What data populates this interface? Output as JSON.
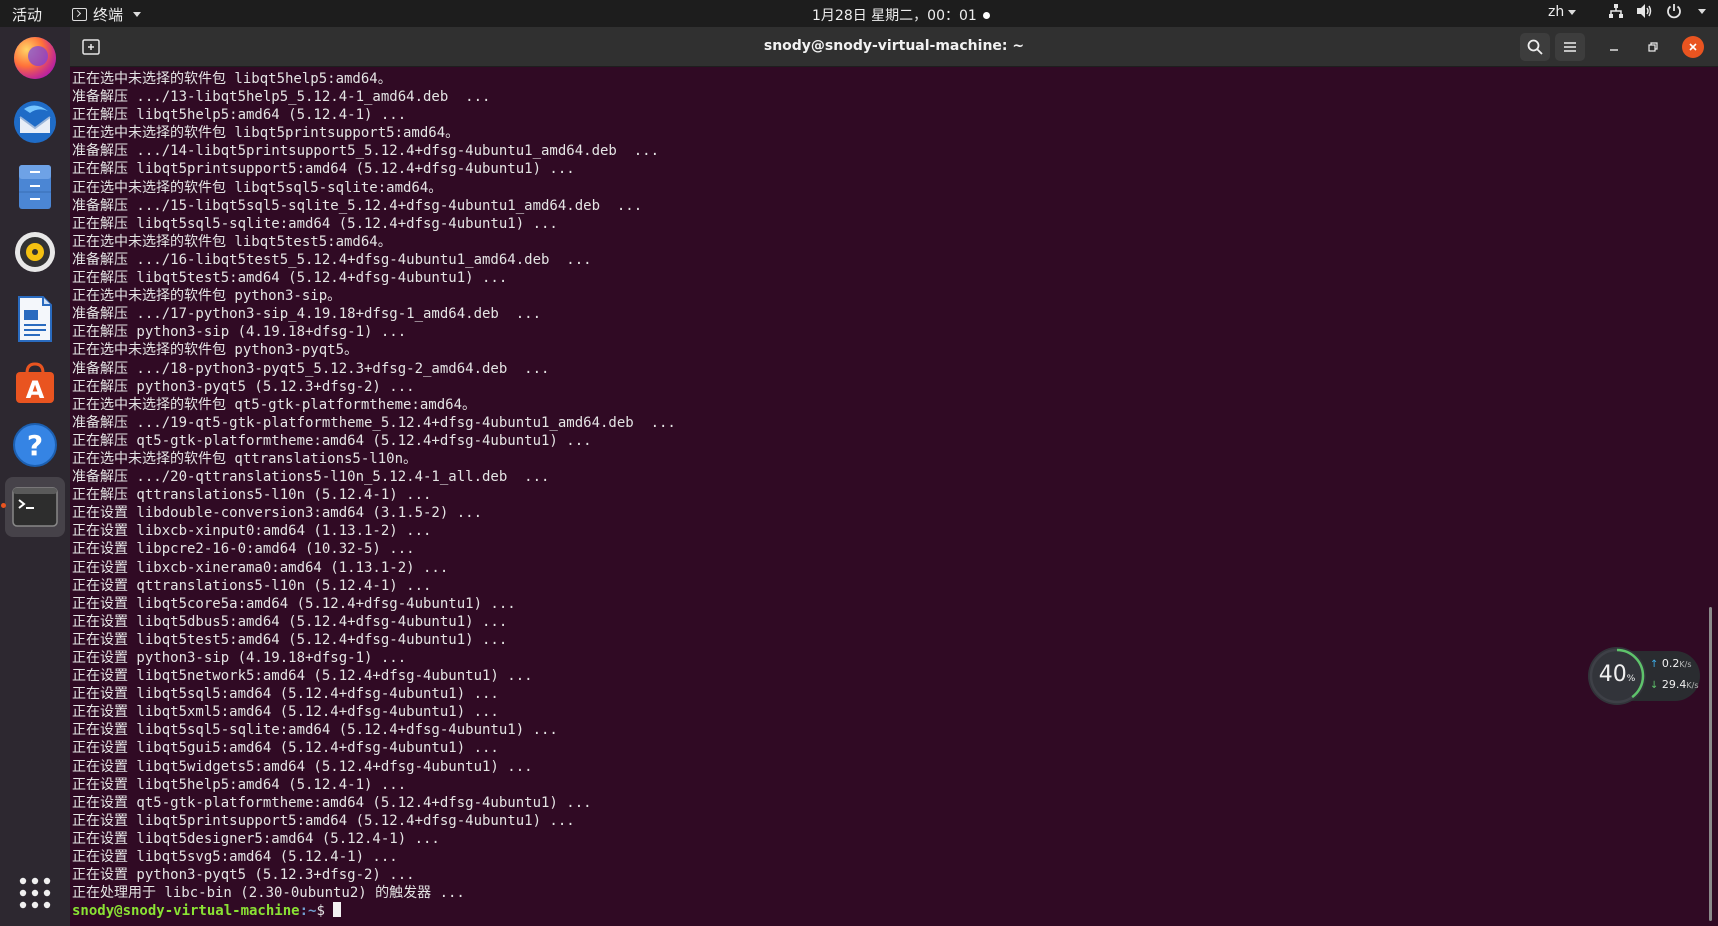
{
  "topbar": {
    "activities": "活动",
    "app_name": "终端",
    "datetime": "1月28日 星期二，00：01",
    "language": "zh"
  },
  "dock": {
    "items": [
      {
        "name": "firefox"
      },
      {
        "name": "thunderbird"
      },
      {
        "name": "files"
      },
      {
        "name": "rhythmbox"
      },
      {
        "name": "libreoffice-writer"
      },
      {
        "name": "ubuntu-software"
      },
      {
        "name": "help"
      },
      {
        "name": "terminal"
      },
      {
        "name": "show-applications"
      }
    ]
  },
  "window": {
    "title": "snody@snody-virtual-machine: ~"
  },
  "terminal": {
    "lines": [
      "正在选中未选择的软件包 libqt5help5:amd64。",
      "准备解压 .../13-libqt5help5_5.12.4-1_amd64.deb  ...",
      "正在解压 libqt5help5:amd64 (5.12.4-1) ...",
      "正在选中未选择的软件包 libqt5printsupport5:amd64。",
      "准备解压 .../14-libqt5printsupport5_5.12.4+dfsg-4ubuntu1_amd64.deb  ...",
      "正在解压 libqt5printsupport5:amd64 (5.12.4+dfsg-4ubuntu1) ...",
      "正在选中未选择的软件包 libqt5sql5-sqlite:amd64。",
      "准备解压 .../15-libqt5sql5-sqlite_5.12.4+dfsg-4ubuntu1_amd64.deb  ...",
      "正在解压 libqt5sql5-sqlite:amd64 (5.12.4+dfsg-4ubuntu1) ...",
      "正在选中未选择的软件包 libqt5test5:amd64。",
      "准备解压 .../16-libqt5test5_5.12.4+dfsg-4ubuntu1_amd64.deb  ...",
      "正在解压 libqt5test5:amd64 (5.12.4+dfsg-4ubuntu1) ...",
      "正在选中未选择的软件包 python3-sip。",
      "准备解压 .../17-python3-sip_4.19.18+dfsg-1_amd64.deb  ...",
      "正在解压 python3-sip (4.19.18+dfsg-1) ...",
      "正在选中未选择的软件包 python3-pyqt5。",
      "准备解压 .../18-python3-pyqt5_5.12.3+dfsg-2_amd64.deb  ...",
      "正在解压 python3-pyqt5 (5.12.3+dfsg-2) ...",
      "正在选中未选择的软件包 qt5-gtk-platformtheme:amd64。",
      "准备解压 .../19-qt5-gtk-platformtheme_5.12.4+dfsg-4ubuntu1_amd64.deb  ...",
      "正在解压 qt5-gtk-platformtheme:amd64 (5.12.4+dfsg-4ubuntu1) ...",
      "正在选中未选择的软件包 qttranslations5-l10n。",
      "准备解压 .../20-qttranslations5-l10n_5.12.4-1_all.deb  ...",
      "正在解压 qttranslations5-l10n (5.12.4-1) ...",
      "正在设置 libdouble-conversion3:amd64 (3.1.5-2) ...",
      "正在设置 libxcb-xinput0:amd64 (1.13.1-2) ...",
      "正在设置 libpcre2-16-0:amd64 (10.32-5) ...",
      "正在设置 libxcb-xinerama0:amd64 (1.13.1-2) ...",
      "正在设置 qttranslations5-l10n (5.12.4-1) ...",
      "正在设置 libqt5core5a:amd64 (5.12.4+dfsg-4ubuntu1) ...",
      "正在设置 libqt5dbus5:amd64 (5.12.4+dfsg-4ubuntu1) ...",
      "正在设置 libqt5test5:amd64 (5.12.4+dfsg-4ubuntu1) ...",
      "正在设置 python3-sip (4.19.18+dfsg-1) ...",
      "正在设置 libqt5network5:amd64 (5.12.4+dfsg-4ubuntu1) ...",
      "正在设置 libqt5sql5:amd64 (5.12.4+dfsg-4ubuntu1) ...",
      "正在设置 libqt5xml5:amd64 (5.12.4+dfsg-4ubuntu1) ...",
      "正在设置 libqt5sql5-sqlite:amd64 (5.12.4+dfsg-4ubuntu1) ...",
      "正在设置 libqt5gui5:amd64 (5.12.4+dfsg-4ubuntu1) ...",
      "正在设置 libqt5widgets5:amd64 (5.12.4+dfsg-4ubuntu1) ...",
      "正在设置 libqt5help5:amd64 (5.12.4-1) ...",
      "正在设置 qt5-gtk-platformtheme:amd64 (5.12.4+dfsg-4ubuntu1) ...",
      "正在设置 libqt5printsupport5:amd64 (5.12.4+dfsg-4ubuntu1) ...",
      "正在设置 libqt5designer5:amd64 (5.12.4-1) ...",
      "正在设置 libqt5svg5:amd64 (5.12.4-1) ...",
      "正在设置 python3-pyqt5 (5.12.3+dfsg-2) ...",
      "正在处理用于 libc-bin (2.30-0ubuntu2) 的触发器 ..."
    ],
    "prompt_user": "snody@snody-virtual-machine",
    "prompt_path": ":~",
    "prompt_symbol": "$ "
  },
  "net_widget": {
    "percent": "40",
    "percent_unit": "%",
    "upload": "0.2",
    "download": "29.4",
    "unit": "K/s"
  }
}
